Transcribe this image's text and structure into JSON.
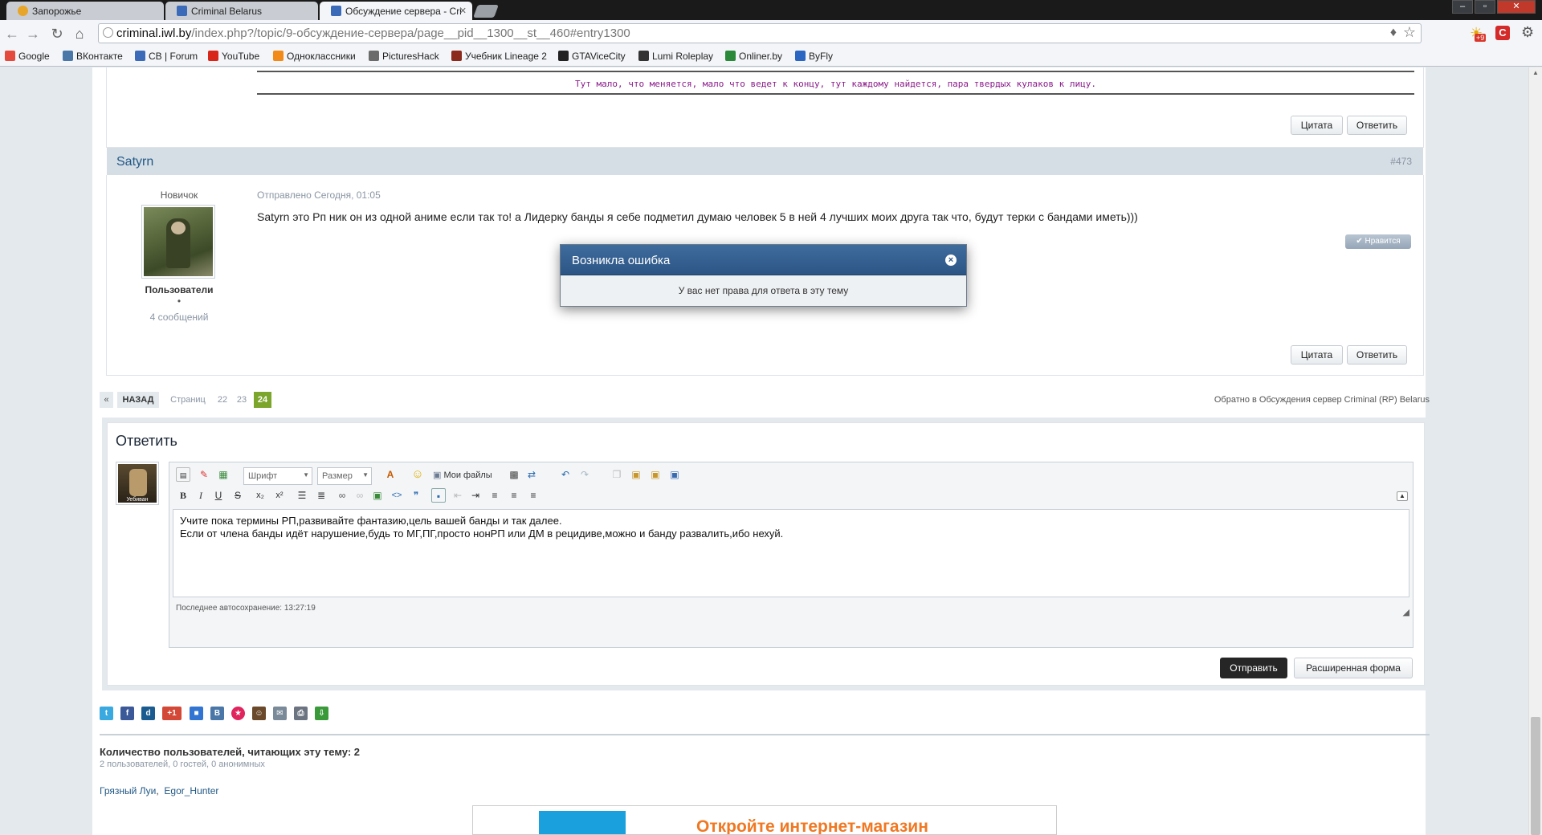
{
  "browser": {
    "tabs": [
      {
        "label": "Запорожье",
        "favicon_color": "#e7a62a"
      },
      {
        "label": "Criminal Belarus",
        "favicon_color": "#3b6ab8"
      },
      {
        "label": "Обсуждение сервера - Cri",
        "favicon_color": "#3b6ab8"
      }
    ],
    "url_host": "criminal.iwl.by",
    "url_rest": "/index.php?/topic/9-обсуждение-сервера/page__pid__1300__st__460#entry1300",
    "ext_badge": "+9",
    "bookmarks": [
      {
        "label": "Google",
        "color": "#e54b3c"
      },
      {
        "label": "ВКонтакте",
        "color": "#4a76a8"
      },
      {
        "label": "CB | Forum",
        "color": "#3b6ab8"
      },
      {
        "label": "YouTube",
        "color": "#d8261b"
      },
      {
        "label": "Одноклассники",
        "color": "#f28a1a"
      },
      {
        "label": "PicturesHack",
        "color": "#6b6b6b"
      },
      {
        "label": "Учебник Lineage 2",
        "color": "#8b2a1d"
      },
      {
        "label": "GTAViceCity",
        "color": "#222222"
      },
      {
        "label": "Lumi Roleplay",
        "color": "#333333"
      },
      {
        "label": "Onliner.by",
        "color": "#2a8a3a"
      },
      {
        "label": "ByFly",
        "color": "#2a66c2"
      }
    ]
  },
  "prev_post": {
    "signature": "Тут мало, что меняется, мало что ведет к концу, тут каждому найдется, пара твердых кулаков к лицу.",
    "quote_label": "Цитата",
    "reply_label": "Ответить"
  },
  "post": {
    "author": "Satyrn",
    "number": "#473",
    "rank": "Новичок",
    "group": "Пользователи",
    "dot": "•",
    "posts_count": "4 сообщений",
    "date": "Отправлено Сегодня, 01:05",
    "text": "Satyrn это Рп ник он из одной аниме если так то! а Лидерку банды я себе подметил думаю человек 5 в ней 4 лучших моих друга так что, будут терки с бандами иметь)))",
    "like_label": "Нравится",
    "quote_label": "Цитата",
    "reply_label": "Ответить"
  },
  "error_dialog": {
    "title": "Возникла ошибка",
    "message": "У вас нет права для ответа в эту тему",
    "close": "×"
  },
  "pagination": {
    "first": "«",
    "back": "НАЗАД",
    "pages_label": "Страниц",
    "pages": [
      "22",
      "23",
      "24"
    ],
    "current": "24",
    "back_link": "Обратно в Обсуждения сервер Criminal (RP) Belarus"
  },
  "reply": {
    "heading": "Ответить",
    "avatar_caption": "Уебиван",
    "font_placeholder": "Шрифт",
    "size_placeholder": "Размер",
    "my_files": "Мои файлы",
    "text_line1": "Учите пока термины РП,развивайте фантазию,цель вашей банды и так далее.",
    "text_line2": "Если от члена банды идёт нарушение,будь то МГ,ПГ,просто нонРП или ДМ в рецидиве,можно и банду развалить,ибо нехуй.",
    "autosave": "Последнее автосохранение: 13:27:19",
    "submit": "Отправить",
    "advanced": "Расширенная форма"
  },
  "share_icons": [
    {
      "name": "twitter-icon",
      "color": "#3aa9e0",
      "glyph": "t"
    },
    {
      "name": "facebook-icon",
      "color": "#3b5998",
      "glyph": "f"
    },
    {
      "name": "digg-icon",
      "color": "#1b5c90",
      "glyph": "d"
    },
    {
      "name": "google-plus-icon",
      "color": "#d34836",
      "glyph": "+1"
    },
    {
      "name": "delicious-icon",
      "color": "#3274d1",
      "glyph": "■"
    },
    {
      "name": "vkontakte-icon",
      "color": "#4a76a8",
      "glyph": "B"
    },
    {
      "name": "favorite-icon",
      "color": "#e0245e",
      "glyph": "★"
    },
    {
      "name": "buddy-icon",
      "color": "#6a4a2a",
      "glyph": "☺"
    },
    {
      "name": "email-icon",
      "color": "#7a8a99",
      "glyph": "✉"
    },
    {
      "name": "print-icon",
      "color": "#6b7480",
      "glyph": "⎙"
    },
    {
      "name": "download-icon",
      "color": "#3a9a3a",
      "glyph": "⇩"
    }
  ],
  "viewers": {
    "title": "Количество пользователей, читающих эту тему: 2",
    "summary": "2 пользователей, 0 гостей, 0 анонимных",
    "users": [
      "Грязный Луи",
      "Egor_Hunter"
    ]
  },
  "ad": {
    "text": "Откройте интернет-магазин"
  }
}
